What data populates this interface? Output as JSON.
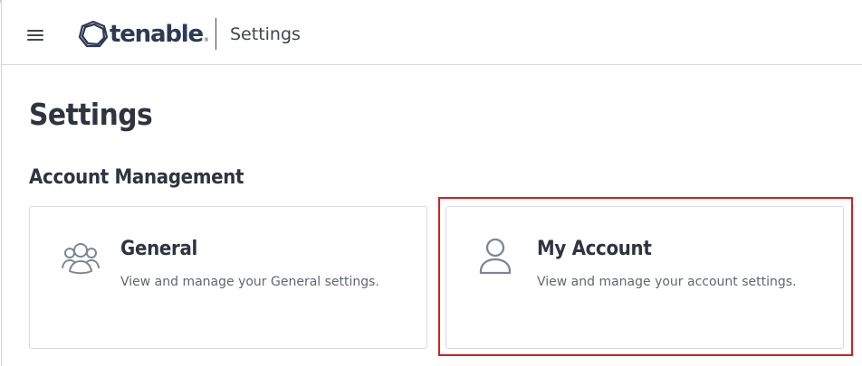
{
  "app": {
    "logo_text": "tenable",
    "logo_reg": "®",
    "header_title": "Settings"
  },
  "page": {
    "title": "Settings",
    "section_title": "Account Management"
  },
  "cards": [
    {
      "title": "General",
      "description": "View and manage your General settings.",
      "icon": "users-icon"
    },
    {
      "title": "My Account",
      "description": "View and manage your account settings.",
      "icon": "user-icon"
    }
  ],
  "colors": {
    "logo": "#2b3a55",
    "text": "#2f3440",
    "muted": "#5f6673",
    "icon": "#7e8594",
    "highlight": "#d61f1f"
  }
}
